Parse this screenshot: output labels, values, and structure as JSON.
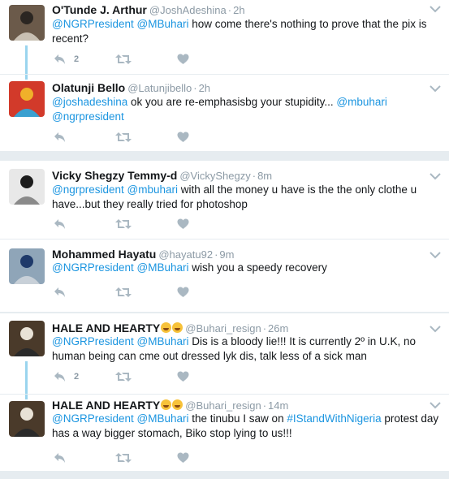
{
  "tweets": [
    {
      "name": "O'Tunde J. Arthur",
      "handle": "@JoshAdeshina",
      "time": "2h",
      "text": [
        {
          "t": "@NGRPresident",
          "link": true
        },
        {
          "t": " ",
          "link": false
        },
        {
          "t": "@MBuhari",
          "link": true
        },
        {
          "t": " how come there's nothing to prove that the pix is recent?",
          "link": false
        }
      ],
      "replies": "2",
      "avatar_colors": [
        "#6b5a4a",
        "#2b2622",
        "#c9c0b3"
      ]
    },
    {
      "name": "Olatunji Bello",
      "handle": "@Latunjibello",
      "time": "2h",
      "text": [
        {
          "t": "@joshadeshina",
          "link": true
        },
        {
          "t": " ok you are re-emphasisbg your stupidity...  ",
          "link": false
        },
        {
          "t": "@mbuhari",
          "link": true
        },
        {
          "t": " ",
          "link": false
        },
        {
          "t": "@ngrpresident",
          "link": true
        }
      ],
      "replies": "",
      "avatar_colors": [
        "#d23a2a",
        "#f0b02a",
        "#3aa0d0"
      ]
    },
    {
      "name": "Vicky Shegzy Temmy-d",
      "handle": "@VickyShegzy",
      "time": "8m",
      "text": [
        {
          "t": "@ngrpresident",
          "link": true
        },
        {
          "t": " ",
          "link": false
        },
        {
          "t": "@mbuhari",
          "link": true
        },
        {
          "t": " with all the money u have is the the only clothe u have...but they really tried for photoshop",
          "link": false
        }
      ],
      "replies": "",
      "avatar_colors": [
        "#e8e8e8",
        "#1d1d1d",
        "#8a8a8a"
      ]
    },
    {
      "name": "Mohammed Hayatu",
      "handle": "@hayatu92",
      "time": "9m",
      "text": [
        {
          "t": "@NGRPresident",
          "link": true
        },
        {
          "t": " ",
          "link": false
        },
        {
          "t": "@MBuhari",
          "link": true
        },
        {
          "t": " wish you a speedy recovery",
          "link": false
        }
      ],
      "replies": "",
      "avatar_colors": [
        "#8fa5b8",
        "#1f3a6a",
        "#c8d0d8"
      ]
    },
    {
      "name": "HALE AND HEARTY",
      "handle": "@Buhari_resign",
      "time": "26m",
      "text": [
        {
          "t": "@NGRPresident",
          "link": true
        },
        {
          "t": " ",
          "link": false
        },
        {
          "t": "@MBuhari",
          "link": true
        },
        {
          "t": " Dis is a bloody lie!!! It is currently 2º in U.K, no human being can cme out dressed lyk dis, talk less of a sick man",
          "link": false
        }
      ],
      "replies": "2",
      "avatar_colors": [
        "#4a3a2a",
        "#e8e2d6",
        "#2a2a2a"
      ]
    },
    {
      "name": "HALE AND HEARTY",
      "handle": "@Buhari_resign",
      "time": "14m",
      "text": [
        {
          "t": "@NGRPresident",
          "link": true
        },
        {
          "t": " ",
          "link": false
        },
        {
          "t": "@MBuhari",
          "link": true
        },
        {
          "t": " the tinubu I saw on ",
          "link": false
        },
        {
          "t": "#IStandWithNigeria",
          "link": true
        },
        {
          "t": " protest day has a way bigger stomach, Biko stop lying to us!!!",
          "link": false
        }
      ],
      "replies": "",
      "avatar_colors": [
        "#4a3a2a",
        "#e8e2d6",
        "#2a2a2a"
      ]
    }
  ],
  "colors": {
    "link": "#1b95e0",
    "icon": "#aab8c2",
    "thread": "#9ad4ee"
  }
}
